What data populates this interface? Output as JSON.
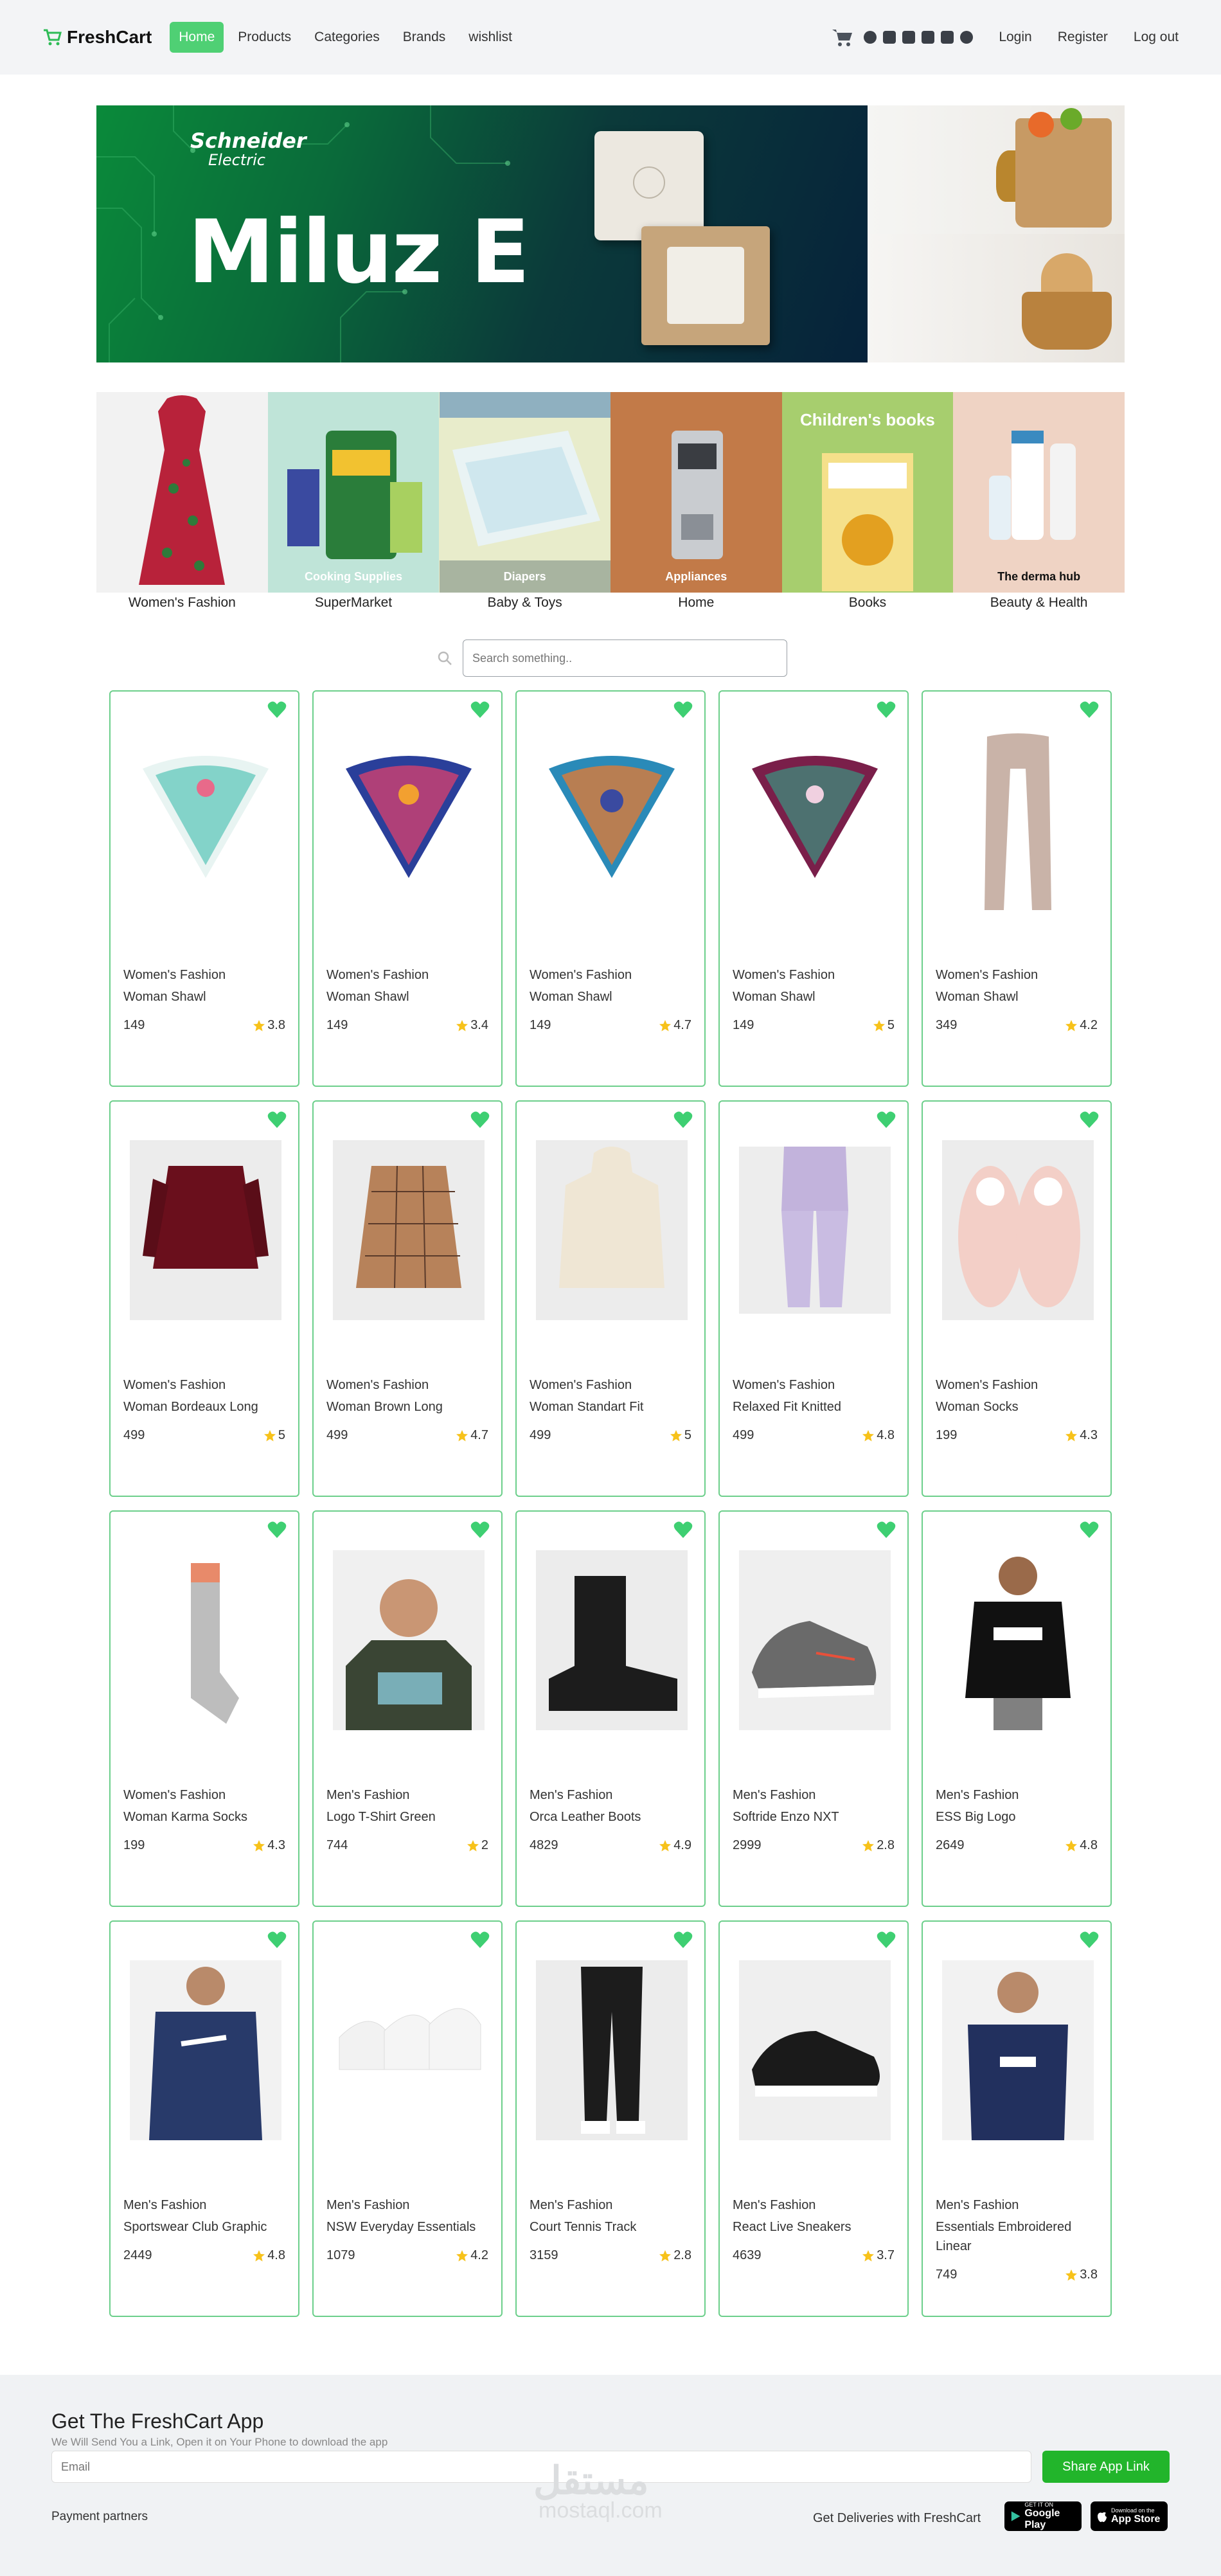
{
  "navbar": {
    "brand": "FreshCart",
    "links": [
      "Home",
      "Products",
      "Categories",
      "Brands",
      "wishlist"
    ],
    "auth": [
      "Login",
      "Register",
      "Log out"
    ]
  },
  "slider": {
    "logo_line1": "Schneider",
    "logo_line2": "Electric",
    "title": "Miluz E"
  },
  "categories": [
    {
      "name": "Women's Fashion",
      "overlay": ""
    },
    {
      "name": "SuperMarket",
      "overlay": "Cooking Supplies"
    },
    {
      "name": "Baby & Toys",
      "overlay": "Diapers"
    },
    {
      "name": "Home",
      "overlay": "Appliances"
    },
    {
      "name": "Books",
      "overlay": "Children's books"
    },
    {
      "name": "Beauty & Health",
      "overlay": "The derma hub"
    }
  ],
  "search": {
    "placeholder": "Search something.."
  },
  "products": [
    {
      "category": "Women's Fashion",
      "title": "Woman Shawl",
      "price": "149",
      "rating": "3.8"
    },
    {
      "category": "Women's Fashion",
      "title": "Woman Shawl",
      "price": "149",
      "rating": "3.4"
    },
    {
      "category": "Women's Fashion",
      "title": "Woman Shawl",
      "price": "149",
      "rating": "4.7"
    },
    {
      "category": "Women's Fashion",
      "title": "Woman Shawl",
      "price": "149",
      "rating": "5"
    },
    {
      "category": "Women's Fashion",
      "title": "Woman Shawl",
      "price": "349",
      "rating": "4.2"
    },
    {
      "category": "Women's Fashion",
      "title": "Woman Bordeaux Long",
      "price": "499",
      "rating": "5"
    },
    {
      "category": "Women's Fashion",
      "title": "Woman Brown Long",
      "price": "499",
      "rating": "4.7"
    },
    {
      "category": "Women's Fashion",
      "title": "Woman Standart Fit",
      "price": "499",
      "rating": "5"
    },
    {
      "category": "Women's Fashion",
      "title": "Relaxed Fit Knitted",
      "price": "499",
      "rating": "4.8"
    },
    {
      "category": "Women's Fashion",
      "title": "Woman Socks",
      "price": "199",
      "rating": "4.3"
    },
    {
      "category": "Women's Fashion",
      "title": "Woman Karma Socks",
      "price": "199",
      "rating": "4.3"
    },
    {
      "category": "Men's Fashion",
      "title": "Logo T-Shirt Green",
      "price": "744",
      "rating": "2"
    },
    {
      "category": "Men's Fashion",
      "title": "Orca Leather Boots",
      "price": "4829",
      "rating": "4.9"
    },
    {
      "category": "Men's Fashion",
      "title": "Softride Enzo NXT",
      "price": "2999",
      "rating": "2.8"
    },
    {
      "category": "Men's Fashion",
      "title": "ESS Big Logo",
      "price": "2649",
      "rating": "4.8"
    },
    {
      "category": "Men's Fashion",
      "title": "Sportswear Club Graphic",
      "price": "2449",
      "rating": "4.8"
    },
    {
      "category": "Men's Fashion",
      "title": "NSW Everyday Essentials",
      "price": "1079",
      "rating": "4.2"
    },
    {
      "category": "Men's Fashion",
      "title": "Court Tennis Track",
      "price": "3159",
      "rating": "2.8"
    },
    {
      "category": "Men's Fashion",
      "title": "React Live Sneakers",
      "price": "4639",
      "rating": "3.7"
    },
    {
      "category": "Men's Fashion",
      "title": "Essentials Embroidered Linear",
      "price": "749",
      "rating": "3.8"
    }
  ],
  "footer": {
    "title": "Get The FreshCart App",
    "subtitle": "We Will Send You a Link, Open it on Your Phone to download the app",
    "email_placeholder": "Email",
    "share_button": "Share App Link",
    "payment_partners": "Payment partners",
    "deliveries": "Get Deliveries with FreshCart",
    "google_play_small": "GET IT ON",
    "google_play": "Google Play",
    "app_store_small": "Download on the",
    "app_store": "App Store",
    "watermark": "مستقل",
    "watermark_sub": "mostaql.com"
  },
  "colors": {
    "accent": "#4fd074",
    "card_border": "#6ccf8b",
    "heart": "#3ecf72",
    "star": "#f7c21a",
    "share_button": "#22b52b"
  }
}
